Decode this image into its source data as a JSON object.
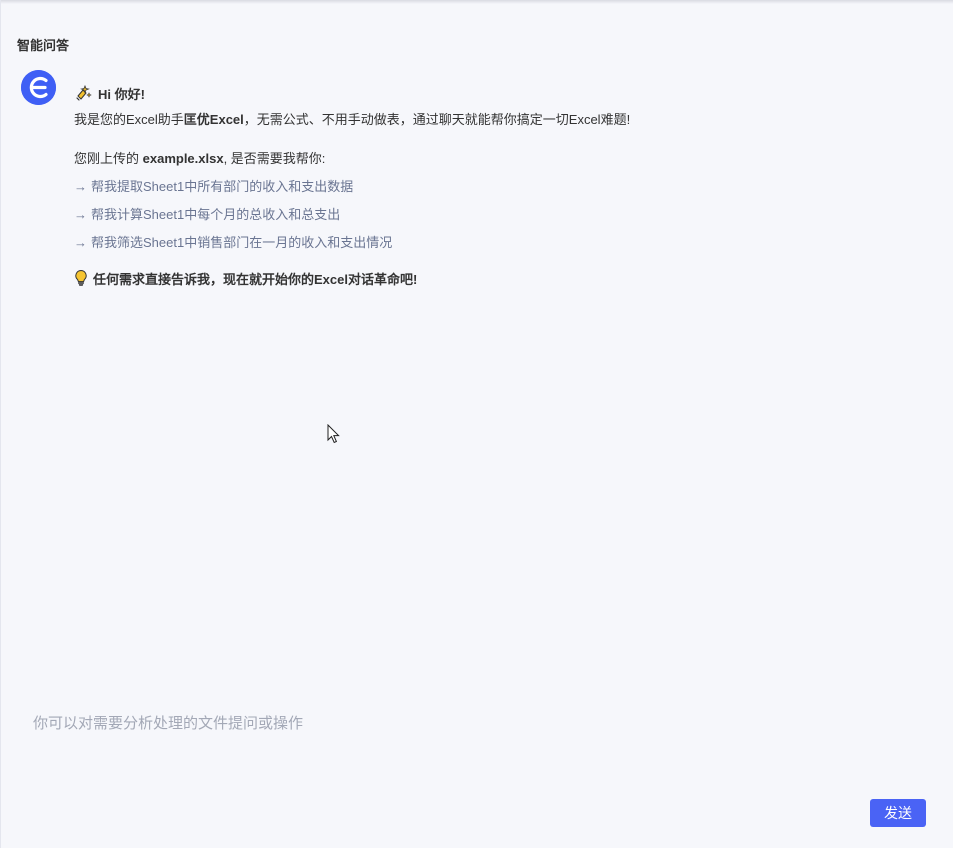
{
  "panel": {
    "title": "智能问答"
  },
  "assistant": {
    "avatar_icon": "excel-e-logo",
    "accent_color": "#3f5ff5"
  },
  "message": {
    "greeting_icon": "sparkle-hand-icon",
    "greeting": "Hi 你好!",
    "intro_prefix": "我是您的Excel助手",
    "intro_name": "匡优Excel",
    "intro_suffix": "，无需公式、不用手动做表，通过聊天就能帮你搞定一切Excel难题!",
    "upload_prefix": "您刚上传的 ",
    "upload_file": "example.xlsx",
    "upload_suffix": ", 是否需要我帮你:",
    "suggestions": [
      {
        "arrow": "→",
        "text": "帮我提取Sheet1中所有部门的收入和支出数据"
      },
      {
        "arrow": "→",
        "text": "帮我计算Sheet1中每个月的总收入和总支出"
      },
      {
        "arrow": "→",
        "text": "帮我筛选Sheet1中销售部门在一月的收入和支出情况"
      }
    ],
    "tip_icon": "lightbulb-icon",
    "tip": "任何需求直接告诉我，现在就开始你的Excel对话革命吧!"
  },
  "composer": {
    "value": "",
    "placeholder": "你可以对需要分析处理的文件提问或操作",
    "send_label": "发送",
    "send_color": "#4a63f5"
  }
}
